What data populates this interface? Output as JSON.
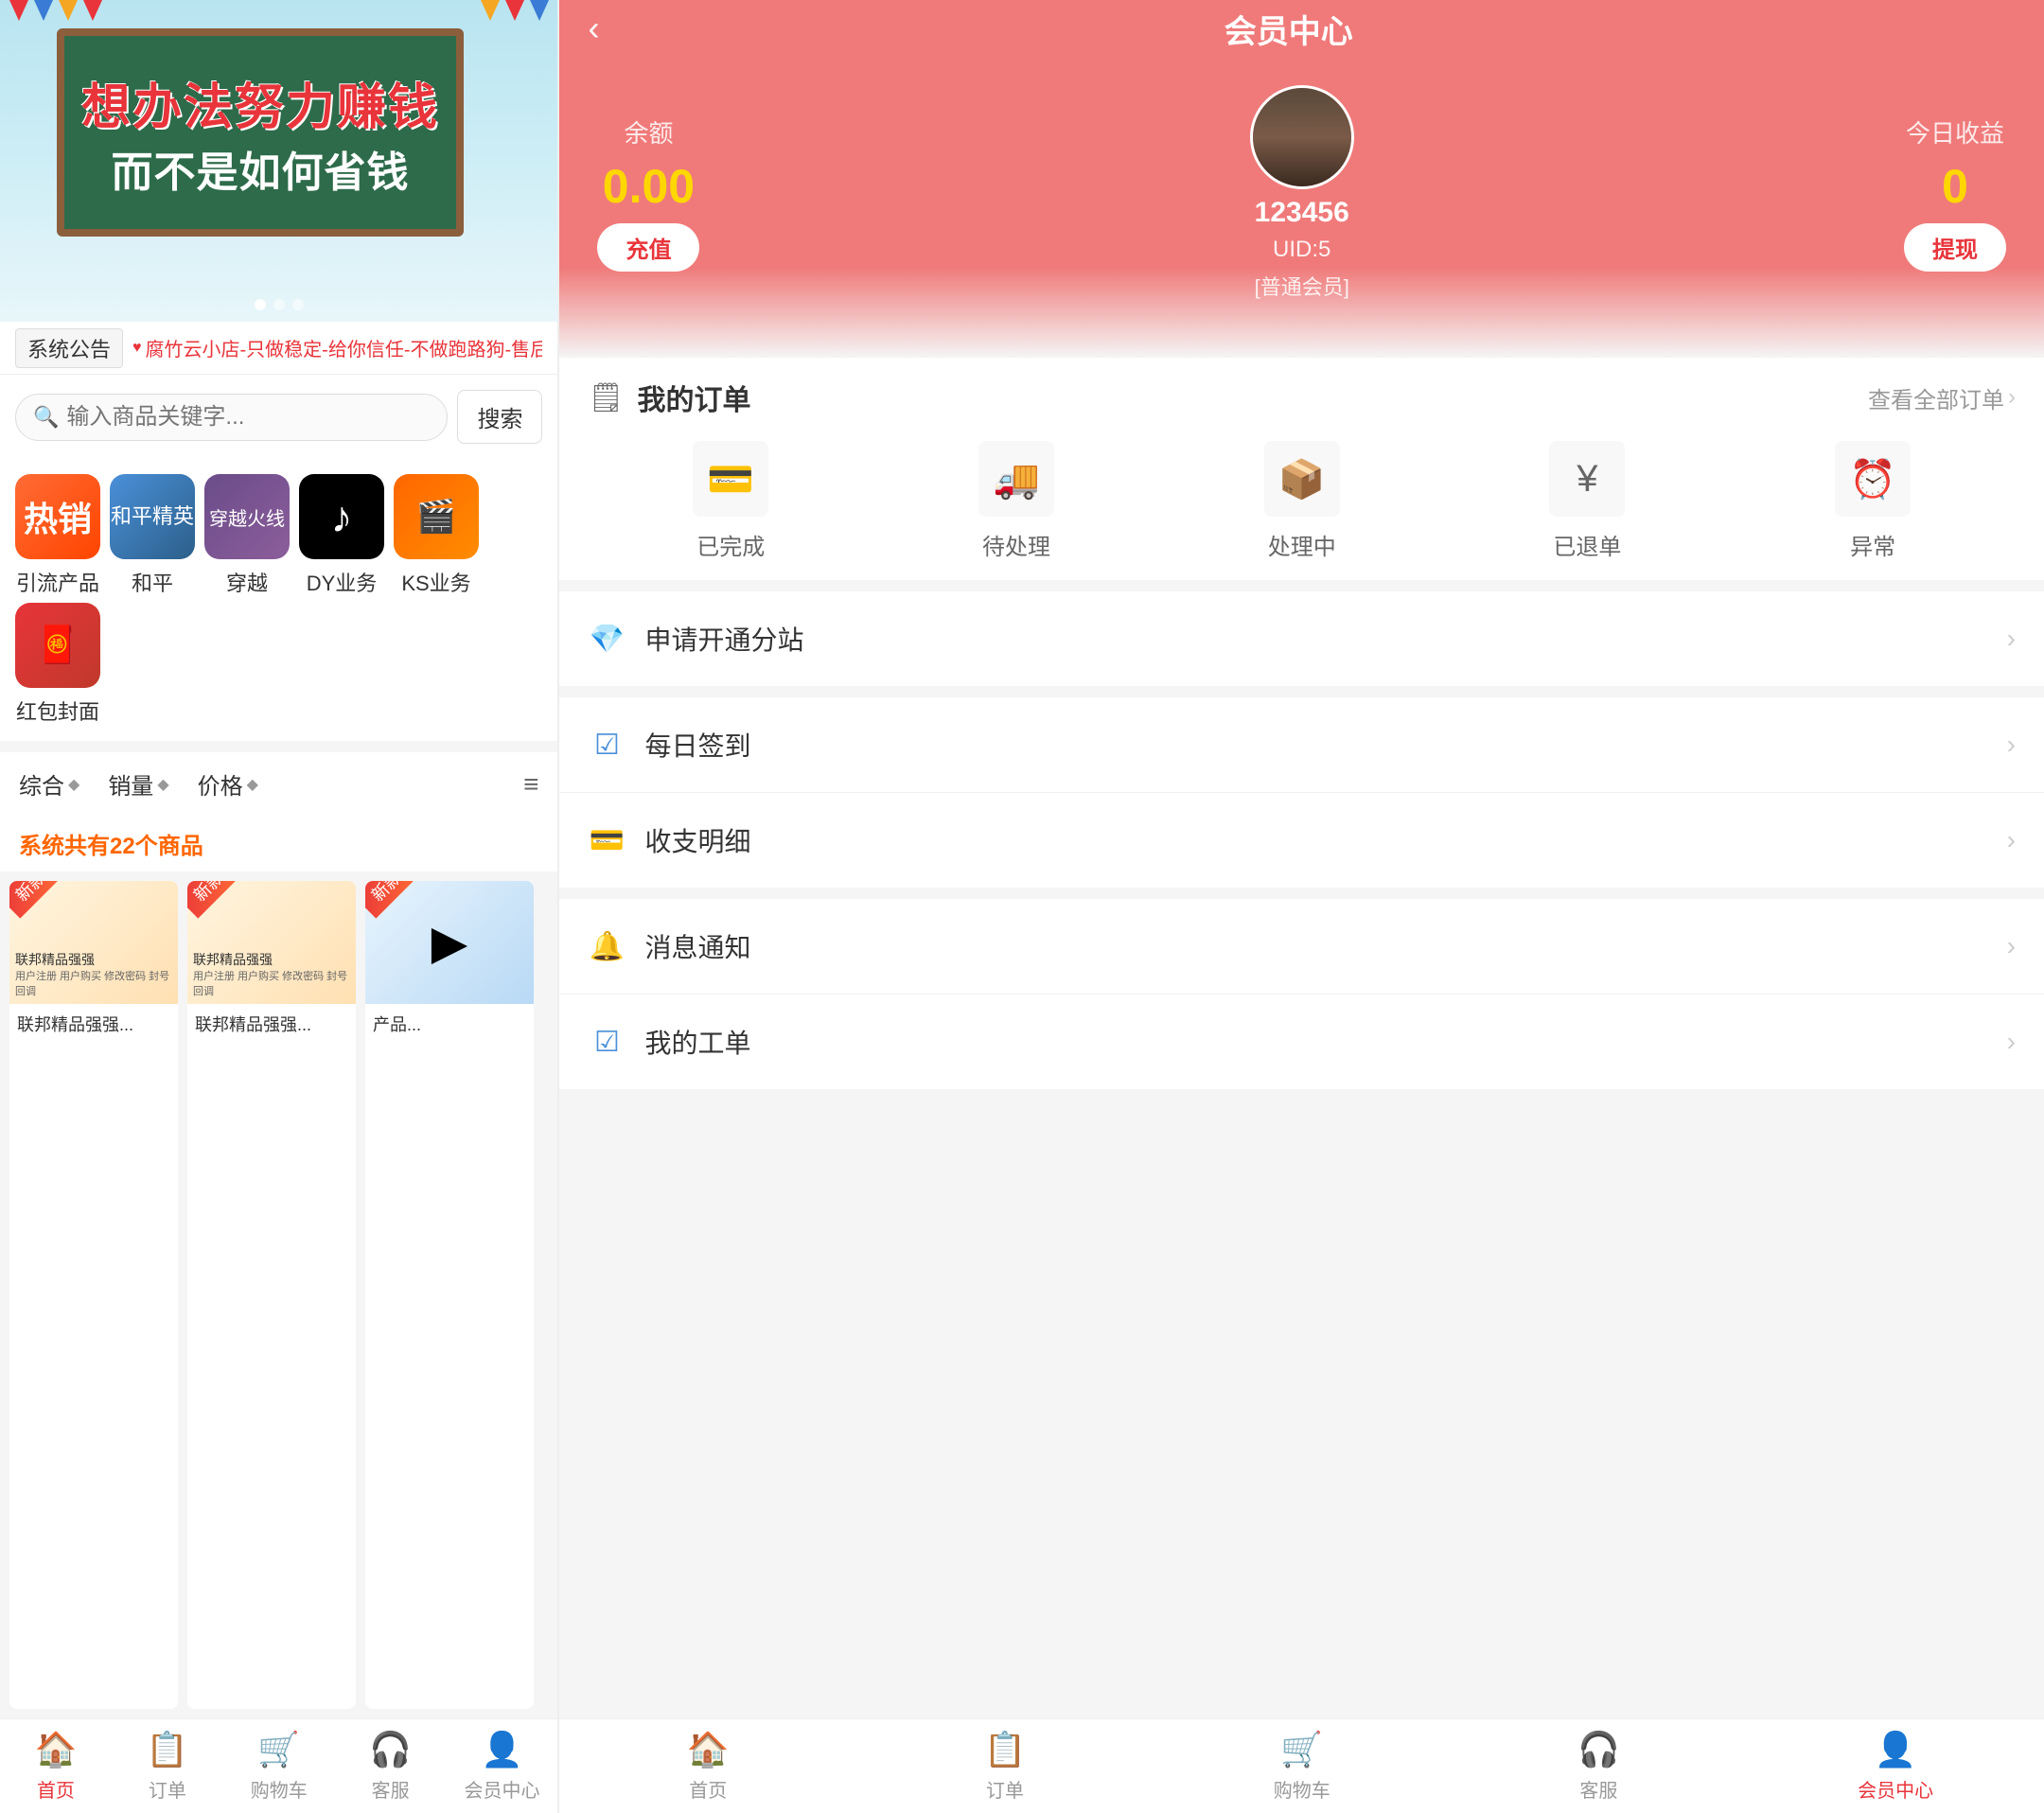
{
  "left": {
    "banner": {
      "text1": "想办法努力赚钱",
      "text2": "而不是如何省钱"
    },
    "notice": {
      "label": "系统公告",
      "text": "腐竹云小店-只做稳定-给你信任-不做跑路狗-售后稳定"
    },
    "search": {
      "placeholder": "输入商品关键字...",
      "button": "搜索"
    },
    "categories": [
      {
        "id": "hot",
        "label": "引流产品",
        "icon": "🔥",
        "class": "cat-hot"
      },
      {
        "id": "peace",
        "label": "和平",
        "icon": "🎮",
        "class": "cat-peace"
      },
      {
        "id": "cross",
        "label": "穿越",
        "icon": "⚔",
        "class": "cat-cross"
      },
      {
        "id": "dy",
        "label": "DY业务",
        "icon": "♪",
        "class": "cat-dy"
      },
      {
        "id": "ks",
        "label": "KS业务",
        "icon": "🎬",
        "class": "cat-ks"
      },
      {
        "id": "red",
        "label": "红包封面",
        "icon": "🧧",
        "class": "cat-red"
      }
    ],
    "sort": {
      "items": [
        "综合",
        "销量",
        "价格"
      ],
      "total": "系统共有22个商品"
    },
    "nav": [
      {
        "label": "首页",
        "icon": "🏠",
        "active": true
      },
      {
        "label": "订单",
        "icon": "📋",
        "active": false
      },
      {
        "label": "购物车",
        "icon": "🛒",
        "active": false
      },
      {
        "label": "客服",
        "icon": "🎧",
        "active": false
      },
      {
        "label": "会员中心",
        "icon": "👤",
        "active": false
      }
    ]
  },
  "right": {
    "header": {
      "title": "会员中心",
      "back": "‹"
    },
    "member": {
      "balance_label": "余额",
      "balance_amount": "0.00",
      "charge_btn": "充值",
      "username": "123456",
      "uid": "UID:5",
      "member_type": "[普通会员]",
      "earnings_label": "今日收益",
      "earnings_amount": "0",
      "withdraw_btn": "提现"
    },
    "orders": {
      "title": "我的订单",
      "view_all": "查看全部订单",
      "statuses": [
        {
          "label": "已完成",
          "icon": "💳"
        },
        {
          "label": "待处理",
          "icon": "🚚"
        },
        {
          "label": "处理中",
          "icon": "📦"
        },
        {
          "label": "已退单",
          "icon": "¥"
        },
        {
          "label": "异常",
          "icon": "⏰",
          "highlight": true
        }
      ]
    },
    "menu": [
      {
        "label": "申请开通分站",
        "icon": "💎",
        "icon_class": "menu-item-icon"
      },
      {
        "label": "每日签到",
        "icon": "☑",
        "icon_class": "menu-item-icon blue"
      },
      {
        "label": "收支明细",
        "icon": "💳",
        "icon_class": "menu-item-icon gray"
      },
      {
        "label": "消息通知",
        "icon": "🔔",
        "icon_class": "menu-item-icon gray"
      },
      {
        "label": "我的工单",
        "icon": "☑",
        "icon_class": "menu-item-icon blue"
      }
    ],
    "nav": [
      {
        "label": "首页",
        "icon": "🏠",
        "active": false
      },
      {
        "label": "订单",
        "icon": "📋",
        "active": false
      },
      {
        "label": "购物车",
        "icon": "🛒",
        "active": false
      },
      {
        "label": "客服",
        "icon": "🎧",
        "active": false
      },
      {
        "label": "会员中心",
        "icon": "👤",
        "active": true
      }
    ]
  }
}
